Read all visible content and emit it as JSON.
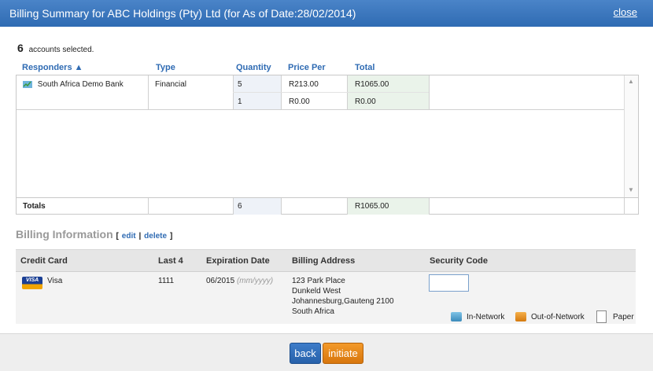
{
  "dialog": {
    "title": "Billing Summary for ABC Holdings (Pty) Ltd (for As of Date:28/02/2014)",
    "close_label": "close"
  },
  "selection": {
    "count": "6",
    "label": "accounts selected."
  },
  "responders_table": {
    "columns": {
      "responders": "Responders ▲",
      "type": "Type",
      "quantity": "Quantity",
      "price_per": "Price Per",
      "total": "Total"
    },
    "rows": [
      {
        "responder": "South Africa Demo Bank",
        "type": "Financial",
        "lines": [
          {
            "quantity": "5",
            "price_per": "R213.00",
            "total": "R1065.00"
          },
          {
            "quantity": "1",
            "price_per": "R0.00",
            "total": "R0.00"
          }
        ]
      }
    ],
    "totals": {
      "label": "Totals",
      "quantity": "6",
      "total": "R1065.00"
    }
  },
  "billing": {
    "title": "Billing Information",
    "edit_label": "edit",
    "separator": "|",
    "delete_label": "delete",
    "bracket_open": "[",
    "bracket_close": "]",
    "columns": {
      "credit_card": "Credit Card",
      "last4": "Last 4",
      "expiration": "Expiration Date",
      "address": "Billing Address",
      "security": "Security Code"
    },
    "card": {
      "brand": "Visa",
      "brand_logo_text": "VISA",
      "last4": "1111",
      "expiration": "06/2015",
      "expiration_hint": "(mm/yyyy)",
      "address_lines": [
        "123 Park Place",
        "Dunkeld West",
        "Johannesburg,Gauteng 2100",
        "South Africa"
      ],
      "security_code": ""
    }
  },
  "legend": {
    "in_network": "In-Network",
    "out_of_network": "Out-of-Network",
    "paper": "Paper"
  },
  "actions": {
    "back_label": "back",
    "initiate_label": "initiate"
  },
  "colors": {
    "titlebar": "#2f6bb3",
    "link": "#2f6bb3",
    "back_button": "#2761aa",
    "initiate_button": "#d7760d"
  }
}
